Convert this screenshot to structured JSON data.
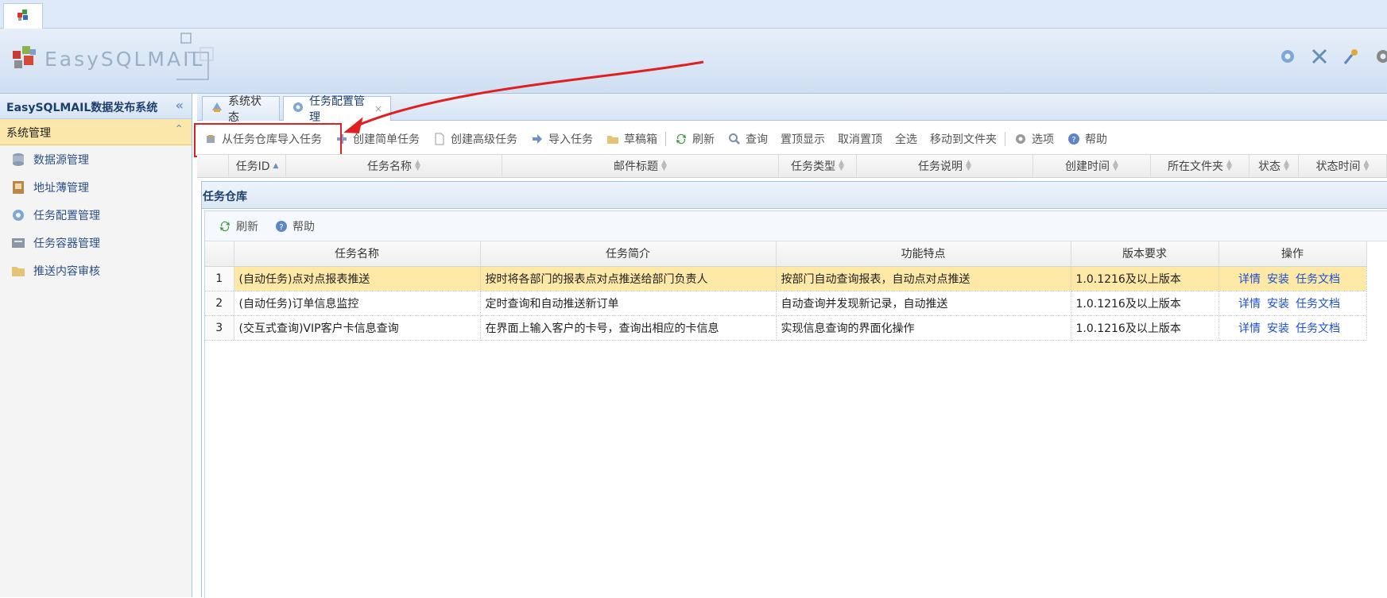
{
  "app": {
    "logo_text": "EasySQLMAIL"
  },
  "sidebar": {
    "title": "EasySQLMAIL数据发布系统",
    "section": "系统管理",
    "items": [
      {
        "label": "数据源管理",
        "icon": "database-icon"
      },
      {
        "label": "地址薄管理",
        "icon": "address-book-icon"
      },
      {
        "label": "任务配置管理",
        "icon": "gear-icon"
      },
      {
        "label": "任务容器管理",
        "icon": "container-icon"
      },
      {
        "label": "推送内容审核",
        "icon": "folder-icon"
      }
    ]
  },
  "tabs": [
    {
      "label": "系统状态",
      "icon": "status-icon"
    },
    {
      "label": "任务配置管理",
      "icon": "gear-icon",
      "close": "×"
    }
  ],
  "toolbar": {
    "import_repo": "从任务仓库导入任务",
    "create_simple": "创建简单任务",
    "create_advanced": "创建高级任务",
    "import_task": "导入任务",
    "drafts": "草稿箱",
    "refresh": "刷新",
    "query": "查询",
    "pin_top": "置顶显示",
    "unpin": "取消置顶",
    "select_all": "全选",
    "move_to_folder": "移动到文件夹",
    "options": "选项",
    "help": "帮助"
  },
  "task_grid": {
    "columns": [
      "任务ID",
      "任务名称",
      "邮件标题",
      "任务类型",
      "任务说明",
      "创建时间",
      "所在文件夹",
      "状态",
      "状态时间"
    ]
  },
  "repository": {
    "title": "任务仓库",
    "toolbar": {
      "refresh": "刷新",
      "help": "帮助"
    },
    "columns": [
      "任务名称",
      "任务简介",
      "功能特点",
      "版本要求",
      "操作"
    ],
    "rows": [
      {
        "num": "1",
        "name": "(自动任务)点对点报表推送",
        "desc": "按时将各部门的报表点对点推送给部门负责人",
        "feature": "按部门自动查询报表，自动点对点推送",
        "version": "1.0.1216及以上版本",
        "selected": true
      },
      {
        "num": "2",
        "name": "(自动任务)订单信息监控",
        "desc": "定时查询和自动推送新订单",
        "feature": "自动查询并发现新记录，自动推送",
        "version": "1.0.1216及以上版本",
        "selected": false
      },
      {
        "num": "3",
        "name": "(交互式查询)VIP客户卡信息查询",
        "desc": "在界面上输入客户的卡号，查询出相应的卡信息",
        "feature": "实现信息查询的界面化操作",
        "version": "1.0.1216及以上版本",
        "selected": false
      }
    ],
    "ops": {
      "detail": "详情",
      "install": "安装",
      "doc": "任务文档"
    }
  },
  "colors": {
    "highlight_border": "#e02020",
    "selected_row": "#fde8a5",
    "link": "#1a4fd1",
    "sidebar_section": "#fbe7a9"
  }
}
